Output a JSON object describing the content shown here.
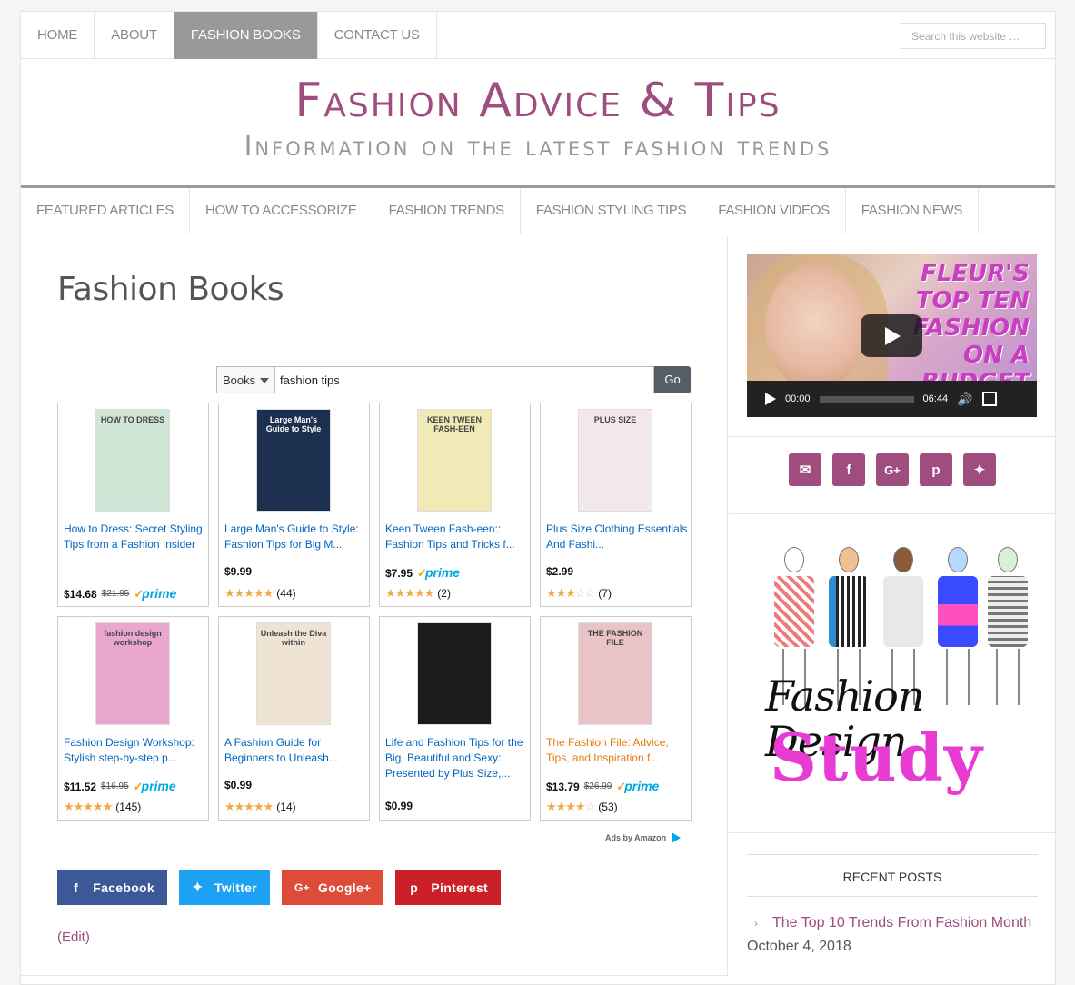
{
  "topnav": {
    "items": [
      "Home",
      "About",
      "Fashion Books",
      "Contact Us"
    ],
    "active_index": 2,
    "search_placeholder": "Search this website …"
  },
  "header": {
    "title": "Fashion Advice & Tips",
    "description": "Information on the latest fashion trends"
  },
  "mainnav": {
    "items": [
      "Featured Articles",
      "How to Accessorize",
      "Fashion Trends",
      "Fashion Styling Tips",
      "Fashion Videos",
      "Fashion News"
    ]
  },
  "page": {
    "title": "Fashion Books"
  },
  "amazon": {
    "category": "Books",
    "query": "fashion tips",
    "go": "Go",
    "ads_label": "Ads by Amazon",
    "products": [
      {
        "title": "How to Dress: Secret Styling Tips from a Fashion Insider",
        "price": "$14.68",
        "list_price": "$21.95",
        "prime": true,
        "rating": null,
        "reviews": null,
        "cover_color": "#cfe6d7",
        "cover_text": "HOW TO DRESS"
      },
      {
        "title": "Large Man's Guide to Style: Fashion Tips for Big M...",
        "price": "$9.99",
        "list_price": null,
        "prime": false,
        "rating": 4.5,
        "reviews": "(44)",
        "cover_color": "#1d2f4e",
        "cover_text": "Large Man's Guide to Style"
      },
      {
        "title": "Keen Tween Fash-een:: Fashion Tips and Tricks f...",
        "price": "$7.95",
        "list_price": null,
        "prime": true,
        "rating": 5,
        "reviews": "(2)",
        "cover_color": "#f2eab6",
        "cover_text": "KEEN TWEEN FASH-EEN"
      },
      {
        "title": "Plus Size Clothing Essentials And Fashi...",
        "price": "$2.99",
        "list_price": null,
        "prime": false,
        "rating": 3,
        "reviews": "(7)",
        "cover_color": "#f4e8ef",
        "cover_text": "PLUS SIZE"
      },
      {
        "title": "Fashion Design Workshop: Stylish step-by-step p...",
        "price": "$11.52",
        "list_price": "$16.95",
        "prime": true,
        "rating": 4.5,
        "reviews": "(145)",
        "cover_color": "#e9a6cf",
        "cover_text": "fashion design workshop"
      },
      {
        "title": "A Fashion Guide for Beginners to Unleash...",
        "price": "$0.99",
        "list_price": null,
        "prime": false,
        "rating": 4.5,
        "reviews": "(14)",
        "cover_color": "#efe3d3",
        "cover_text": "Unleash the Diva within"
      },
      {
        "title": "Life and Fashion Tips for the Big, Beautiful and Sexy: Presented by Plus Size,...",
        "price": "$0.99",
        "list_price": null,
        "prime": false,
        "rating": null,
        "reviews": null,
        "cover_color": "#1b1b1b",
        "cover_text": ""
      },
      {
        "title": "The Fashion File: Advice, Tips, and Inspiration f...",
        "price": "$13.79",
        "list_price": "$26.99",
        "prime": true,
        "rating": 4,
        "reviews": "(53)",
        "cover_color": "#e8c4c7",
        "cover_text": "THE FASHION FILE"
      }
    ]
  },
  "share": {
    "facebook": "Facebook",
    "twitter": "Twitter",
    "googleplus": "Google+",
    "pinterest": "Pinterest",
    "edit": "(Edit)"
  },
  "sidebar": {
    "video": {
      "overlay_text": "FLEUR'S TOP TEN FASHION ON A BUDGET",
      "current_time": "00:00",
      "duration": "06:44"
    },
    "social_icons": [
      "email-icon",
      "facebook-icon",
      "google-plus-icon",
      "pinterest-icon",
      "twitter-icon"
    ],
    "fds_script": "Fashion Design",
    "fds_study": "Study",
    "recent_heading": "Recent Posts",
    "recent_posts": [
      {
        "title": "The Top 10 Trends From Fashion Month",
        "date": "October 4, 2018"
      }
    ]
  }
}
